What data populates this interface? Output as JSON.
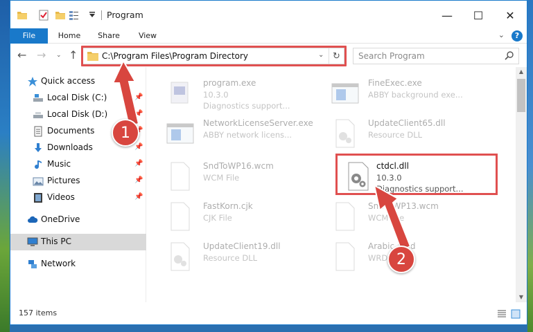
{
  "window": {
    "title": "Program",
    "minimize": "—",
    "maximize": "☐",
    "close": "✕"
  },
  "ribbon": {
    "tabs": [
      "File",
      "Home",
      "Share",
      "View"
    ]
  },
  "navigation": {
    "address": "C:\\Program Files\\Program Directory",
    "search_placeholder": "Search Program"
  },
  "sidebar": {
    "items": [
      {
        "label": "Quick access",
        "icon": "star-icon",
        "pinned": false
      },
      {
        "label": "Local Disk (C:)",
        "icon": "drive-icon",
        "pinned": true
      },
      {
        "label": "Local Disk (D:)",
        "icon": "drive-icon",
        "pinned": true
      },
      {
        "label": "Documents",
        "icon": "document-icon",
        "pinned": true
      },
      {
        "label": "Downloads",
        "icon": "download-icon",
        "pinned": true
      },
      {
        "label": "Music",
        "icon": "music-icon",
        "pinned": true
      },
      {
        "label": "Pictures",
        "icon": "pictures-icon",
        "pinned": true
      },
      {
        "label": "Videos",
        "icon": "video-icon",
        "pinned": true
      },
      {
        "label": "OneDrive",
        "icon": "cloud-icon",
        "pinned": false
      },
      {
        "label": "This PC",
        "icon": "computer-icon",
        "pinned": false,
        "selected": true
      },
      {
        "label": "Network",
        "icon": "network-icon",
        "pinned": false
      }
    ]
  },
  "files": [
    {
      "name": "program.exe",
      "line2": "10.3.0",
      "line3": "Diagnostics support...",
      "icon": "exe-icon",
      "faded": true
    },
    {
      "name": "FineExec.exe",
      "line2": "ABBY background exe...",
      "line3": "",
      "icon": "window-icon",
      "faded": true
    },
    {
      "name": "NetworkLicenseServer.exe",
      "line2": "ABBY network licens...",
      "line3": "",
      "icon": "window-icon",
      "faded": true
    },
    {
      "name": "UpdateClient65.dll",
      "line2": "Resource DLL",
      "line3": "",
      "icon": "dll-icon",
      "faded": true
    },
    {
      "name": "SndToWP16.wcm",
      "line2": "WCM File",
      "line3": "",
      "icon": "file-icon",
      "faded": true
    },
    {
      "name": "ctdcl.dll",
      "line2": "10.3.0",
      "line3": "Diagnostics support...",
      "icon": "dll-icon",
      "faded": false
    },
    {
      "name": "FastKorn.cjk",
      "line2": "CJK File",
      "line3": "",
      "icon": "file-icon",
      "faded": true
    },
    {
      "name": "SndToWP13.wcm",
      "line2": "WCM File",
      "line3": "",
      "icon": "file-icon",
      "faded": true
    },
    {
      "name": "UpdateClient19.dll",
      "line2": "Resource DLL",
      "line3": "",
      "icon": "dll-icon",
      "faded": true
    },
    {
      "name": "Arabic.amd",
      "line2": "WRD File",
      "line3": "",
      "icon": "file-icon",
      "faded": true
    }
  ],
  "status": {
    "count": "157 items"
  },
  "callouts": [
    "1",
    "2"
  ],
  "colors": {
    "accent": "#1979ca",
    "highlight": "#e05050"
  }
}
